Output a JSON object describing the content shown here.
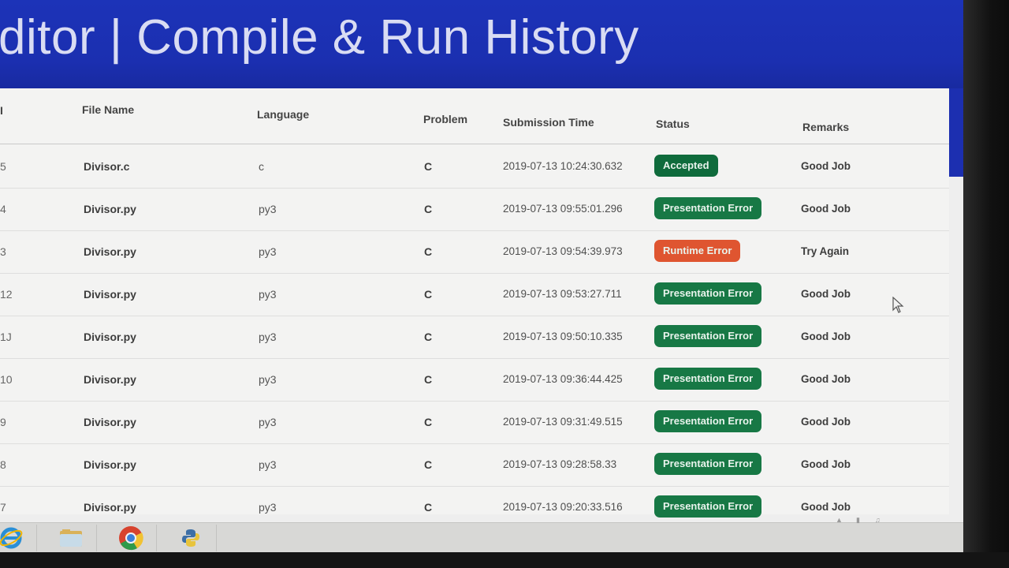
{
  "header": {
    "title": "ditor | Compile & Run History"
  },
  "table": {
    "columns": {
      "id": "I",
      "file_name": "File Name",
      "language": "Language",
      "problem": "Problem",
      "submission_time": "Submission Time",
      "status": "Status",
      "remarks": "Remarks"
    },
    "rows": [
      {
        "id": "5",
        "file": "Divisor.c",
        "lang": "c",
        "problem": "C",
        "time": "2019-07-13 10:24:30.632",
        "status": "Accepted",
        "status_color": "#0f6b3c",
        "remarks": "Good Job"
      },
      {
        "id": "4",
        "file": "Divisor.py",
        "lang": "py3",
        "problem": "C",
        "time": "2019-07-13 09:55:01.296",
        "status": "Presentation Error",
        "status_color": "#177845",
        "remarks": "Good Job"
      },
      {
        "id": "3",
        "file": "Divisor.py",
        "lang": "py3",
        "problem": "C",
        "time": "2019-07-13 09:54:39.973",
        "status": "Runtime Error",
        "status_color": "#df5530",
        "remarks": "Try Again"
      },
      {
        "id": "12",
        "file": "Divisor.py",
        "lang": "py3",
        "problem": "C",
        "time": "2019-07-13 09:53:27.711",
        "status": "Presentation Error",
        "status_color": "#177845",
        "remarks": "Good Job"
      },
      {
        "id": "1J",
        "file": "Divisor.py",
        "lang": "py3",
        "problem": "C",
        "time": "2019-07-13 09:50:10.335",
        "status": "Presentation Error",
        "status_color": "#177845",
        "remarks": "Good Job"
      },
      {
        "id": "10",
        "file": "Divisor.py",
        "lang": "py3",
        "problem": "C",
        "time": "2019-07-13 09:36:44.425",
        "status": "Presentation Error",
        "status_color": "#177845",
        "remarks": "Good Job"
      },
      {
        "id": "9",
        "file": "Divisor.py",
        "lang": "py3",
        "problem": "C",
        "time": "2019-07-13 09:31:49.515",
        "status": "Presentation Error",
        "status_color": "#177845",
        "remarks": "Good Job"
      },
      {
        "id": "8",
        "file": "Divisor.py",
        "lang": "py3",
        "problem": "C",
        "time": "2019-07-13 09:28:58.33",
        "status": "Presentation Error",
        "status_color": "#177845",
        "remarks": "Good Job"
      },
      {
        "id": "7",
        "file": "Divisor.py",
        "lang": "py3",
        "problem": "C",
        "time": "2019-07-13 09:20:33.516",
        "status": "Presentation Error",
        "status_color": "#177845",
        "remarks": "Good Job"
      }
    ]
  },
  "taskbar": {
    "apps": [
      {
        "name": "internet-explorer-icon"
      },
      {
        "name": "file-explorer-icon"
      },
      {
        "name": "chrome-icon"
      },
      {
        "name": "python-icon"
      }
    ]
  },
  "colors": {
    "header_blue": "#1b2fb0",
    "accepted_green": "#0f6b3c",
    "presentation_green": "#177845",
    "runtime_red": "#df5530"
  }
}
